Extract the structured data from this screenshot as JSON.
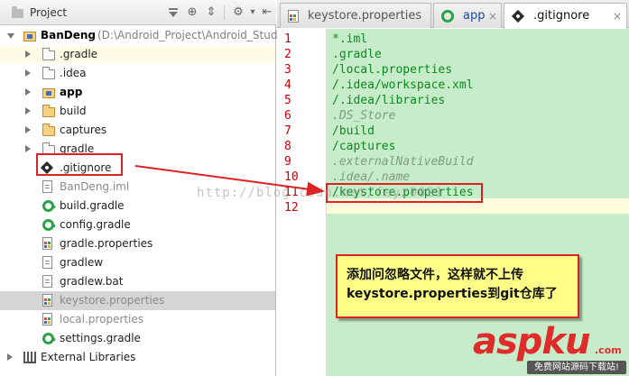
{
  "project_panel": {
    "title": "Project",
    "header_icons": [
      "target-icon",
      "collapse-icon",
      "settings-icon",
      "hide-icon"
    ],
    "tree": [
      {
        "label": "BanDeng",
        "path": "(D:\\Android_Project\\Android_Studi",
        "icon": "module-icon",
        "bold": true,
        "expanded": true
      },
      {
        "label": ".gradle",
        "icon": "folder-icon",
        "expandable": true
      },
      {
        "label": ".idea",
        "icon": "folder-icon",
        "expandable": true
      },
      {
        "label": "app",
        "icon": "module-icon",
        "expandable": true,
        "bold": true
      },
      {
        "label": "build",
        "icon": "folder-icon",
        "expandable": true,
        "orange": true
      },
      {
        "label": "captures",
        "icon": "folder-icon",
        "expandable": true,
        "orange": true
      },
      {
        "label": "gradle",
        "icon": "folder-icon",
        "expandable": true
      },
      {
        "label": ".gitignore",
        "icon": "git-icon"
      },
      {
        "label": "BanDeng.iml",
        "icon": "file-icon",
        "dim": true
      },
      {
        "label": "build.gradle",
        "icon": "gradle-icon"
      },
      {
        "label": "config.gradle",
        "icon": "gradle-icon"
      },
      {
        "label": "gradle.properties",
        "icon": "properties-icon"
      },
      {
        "label": "gradlew",
        "icon": "file-icon"
      },
      {
        "label": "gradlew.bat",
        "icon": "file-icon"
      },
      {
        "label": "keystore.properties",
        "icon": "properties-icon",
        "dim": true,
        "selected": true
      },
      {
        "label": "local.properties",
        "icon": "properties-icon",
        "dim": true
      },
      {
        "label": "settings.gradle",
        "icon": "gradle-icon"
      },
      {
        "label": "External Libraries",
        "icon": "libraries-icon",
        "expandable": true
      }
    ]
  },
  "editor": {
    "tabs": [
      {
        "label": "keystore.properties",
        "icon": "properties-icon",
        "active": false
      },
      {
        "label": "app",
        "icon": "gradle-icon",
        "active": false
      },
      {
        "label": ".gitignore",
        "icon": "git-icon",
        "active": true
      }
    ],
    "lines": [
      {
        "num": "1",
        "text": "*.iml",
        "comment": false
      },
      {
        "num": "2",
        "text": ".gradle",
        "comment": false
      },
      {
        "num": "3",
        "text": "/local.properties",
        "comment": false
      },
      {
        "num": "4",
        "text": "/.idea/workspace.xml",
        "comment": false
      },
      {
        "num": "5",
        "text": "/.idea/libraries",
        "comment": false
      },
      {
        "num": "6",
        "text": ".DS_Store",
        "comment": true
      },
      {
        "num": "7",
        "text": "/build",
        "comment": false
      },
      {
        "num": "8",
        "text": "/captures",
        "comment": false
      },
      {
        "num": "9",
        "text": ".externalNativeBuild",
        "comment": true
      },
      {
        "num": "10",
        "text": ".idea/.name",
        "comment": true
      },
      {
        "num": "11",
        "text": "/keystore.properties",
        "comment": false
      },
      {
        "num": "12",
        "text": "",
        "comment": false
      }
    ]
  },
  "annotation": {
    "callout_line1": "添加问忽略文件，这样就不上传",
    "callout_line2": "keystore.properties到git仓库了"
  },
  "watermark": "http://blog.csdn.net/fayz0021",
  "logo": {
    "brand": "aspku",
    "suffix": ".com",
    "sub": "免费网站源码下载站!"
  },
  "colors": {
    "code_bg": "#c7ecc9",
    "line_numbers": "#c8000a",
    "code_text": "#0a8a20",
    "annotation_red": "#dd2222",
    "callout_bg": "#ffff87",
    "logo_red": "#e02b2b"
  }
}
